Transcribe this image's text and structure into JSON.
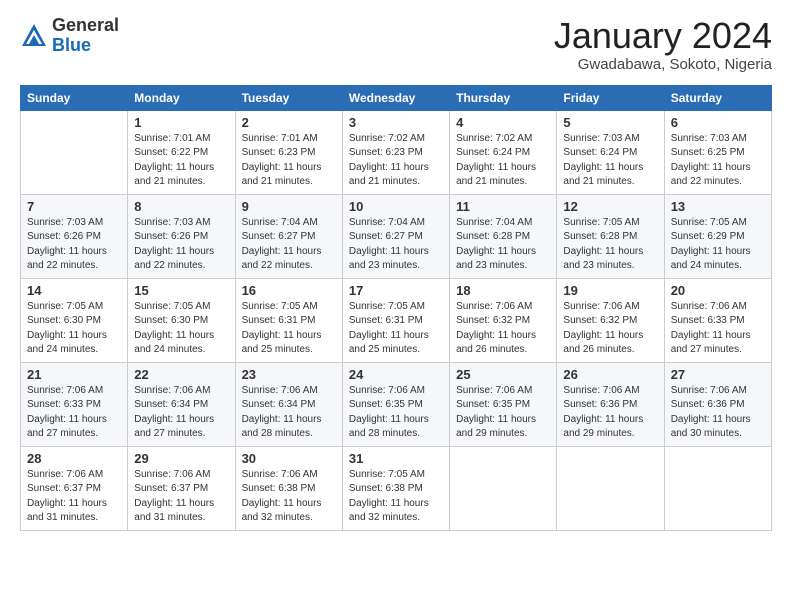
{
  "logo": {
    "general": "General",
    "blue": "Blue"
  },
  "header": {
    "month_year": "January 2024",
    "location": "Gwadabawa, Sokoto, Nigeria"
  },
  "days_of_week": [
    "Sunday",
    "Monday",
    "Tuesday",
    "Wednesday",
    "Thursday",
    "Friday",
    "Saturday"
  ],
  "weeks": [
    [
      {
        "day": "",
        "info": ""
      },
      {
        "day": "1",
        "info": "Sunrise: 7:01 AM\nSunset: 6:22 PM\nDaylight: 11 hours\nand 21 minutes."
      },
      {
        "day": "2",
        "info": "Sunrise: 7:01 AM\nSunset: 6:23 PM\nDaylight: 11 hours\nand 21 minutes."
      },
      {
        "day": "3",
        "info": "Sunrise: 7:02 AM\nSunset: 6:23 PM\nDaylight: 11 hours\nand 21 minutes."
      },
      {
        "day": "4",
        "info": "Sunrise: 7:02 AM\nSunset: 6:24 PM\nDaylight: 11 hours\nand 21 minutes."
      },
      {
        "day": "5",
        "info": "Sunrise: 7:03 AM\nSunset: 6:24 PM\nDaylight: 11 hours\nand 21 minutes."
      },
      {
        "day": "6",
        "info": "Sunrise: 7:03 AM\nSunset: 6:25 PM\nDaylight: 11 hours\nand 22 minutes."
      }
    ],
    [
      {
        "day": "7",
        "info": "Sunrise: 7:03 AM\nSunset: 6:26 PM\nDaylight: 11 hours\nand 22 minutes."
      },
      {
        "day": "8",
        "info": "Sunrise: 7:03 AM\nSunset: 6:26 PM\nDaylight: 11 hours\nand 22 minutes."
      },
      {
        "day": "9",
        "info": "Sunrise: 7:04 AM\nSunset: 6:27 PM\nDaylight: 11 hours\nand 22 minutes."
      },
      {
        "day": "10",
        "info": "Sunrise: 7:04 AM\nSunset: 6:27 PM\nDaylight: 11 hours\nand 23 minutes."
      },
      {
        "day": "11",
        "info": "Sunrise: 7:04 AM\nSunset: 6:28 PM\nDaylight: 11 hours\nand 23 minutes."
      },
      {
        "day": "12",
        "info": "Sunrise: 7:05 AM\nSunset: 6:28 PM\nDaylight: 11 hours\nand 23 minutes."
      },
      {
        "day": "13",
        "info": "Sunrise: 7:05 AM\nSunset: 6:29 PM\nDaylight: 11 hours\nand 24 minutes."
      }
    ],
    [
      {
        "day": "14",
        "info": "Sunrise: 7:05 AM\nSunset: 6:30 PM\nDaylight: 11 hours\nand 24 minutes."
      },
      {
        "day": "15",
        "info": "Sunrise: 7:05 AM\nSunset: 6:30 PM\nDaylight: 11 hours\nand 24 minutes."
      },
      {
        "day": "16",
        "info": "Sunrise: 7:05 AM\nSunset: 6:31 PM\nDaylight: 11 hours\nand 25 minutes."
      },
      {
        "day": "17",
        "info": "Sunrise: 7:05 AM\nSunset: 6:31 PM\nDaylight: 11 hours\nand 25 minutes."
      },
      {
        "day": "18",
        "info": "Sunrise: 7:06 AM\nSunset: 6:32 PM\nDaylight: 11 hours\nand 26 minutes."
      },
      {
        "day": "19",
        "info": "Sunrise: 7:06 AM\nSunset: 6:32 PM\nDaylight: 11 hours\nand 26 minutes."
      },
      {
        "day": "20",
        "info": "Sunrise: 7:06 AM\nSunset: 6:33 PM\nDaylight: 11 hours\nand 27 minutes."
      }
    ],
    [
      {
        "day": "21",
        "info": "Sunrise: 7:06 AM\nSunset: 6:33 PM\nDaylight: 11 hours\nand 27 minutes."
      },
      {
        "day": "22",
        "info": "Sunrise: 7:06 AM\nSunset: 6:34 PM\nDaylight: 11 hours\nand 27 minutes."
      },
      {
        "day": "23",
        "info": "Sunrise: 7:06 AM\nSunset: 6:34 PM\nDaylight: 11 hours\nand 28 minutes."
      },
      {
        "day": "24",
        "info": "Sunrise: 7:06 AM\nSunset: 6:35 PM\nDaylight: 11 hours\nand 28 minutes."
      },
      {
        "day": "25",
        "info": "Sunrise: 7:06 AM\nSunset: 6:35 PM\nDaylight: 11 hours\nand 29 minutes."
      },
      {
        "day": "26",
        "info": "Sunrise: 7:06 AM\nSunset: 6:36 PM\nDaylight: 11 hours\nand 29 minutes."
      },
      {
        "day": "27",
        "info": "Sunrise: 7:06 AM\nSunset: 6:36 PM\nDaylight: 11 hours\nand 30 minutes."
      }
    ],
    [
      {
        "day": "28",
        "info": "Sunrise: 7:06 AM\nSunset: 6:37 PM\nDaylight: 11 hours\nand 31 minutes."
      },
      {
        "day": "29",
        "info": "Sunrise: 7:06 AM\nSunset: 6:37 PM\nDaylight: 11 hours\nand 31 minutes."
      },
      {
        "day": "30",
        "info": "Sunrise: 7:06 AM\nSunset: 6:38 PM\nDaylight: 11 hours\nand 32 minutes."
      },
      {
        "day": "31",
        "info": "Sunrise: 7:05 AM\nSunset: 6:38 PM\nDaylight: 11 hours\nand 32 minutes."
      },
      {
        "day": "",
        "info": ""
      },
      {
        "day": "",
        "info": ""
      },
      {
        "day": "",
        "info": ""
      }
    ]
  ]
}
